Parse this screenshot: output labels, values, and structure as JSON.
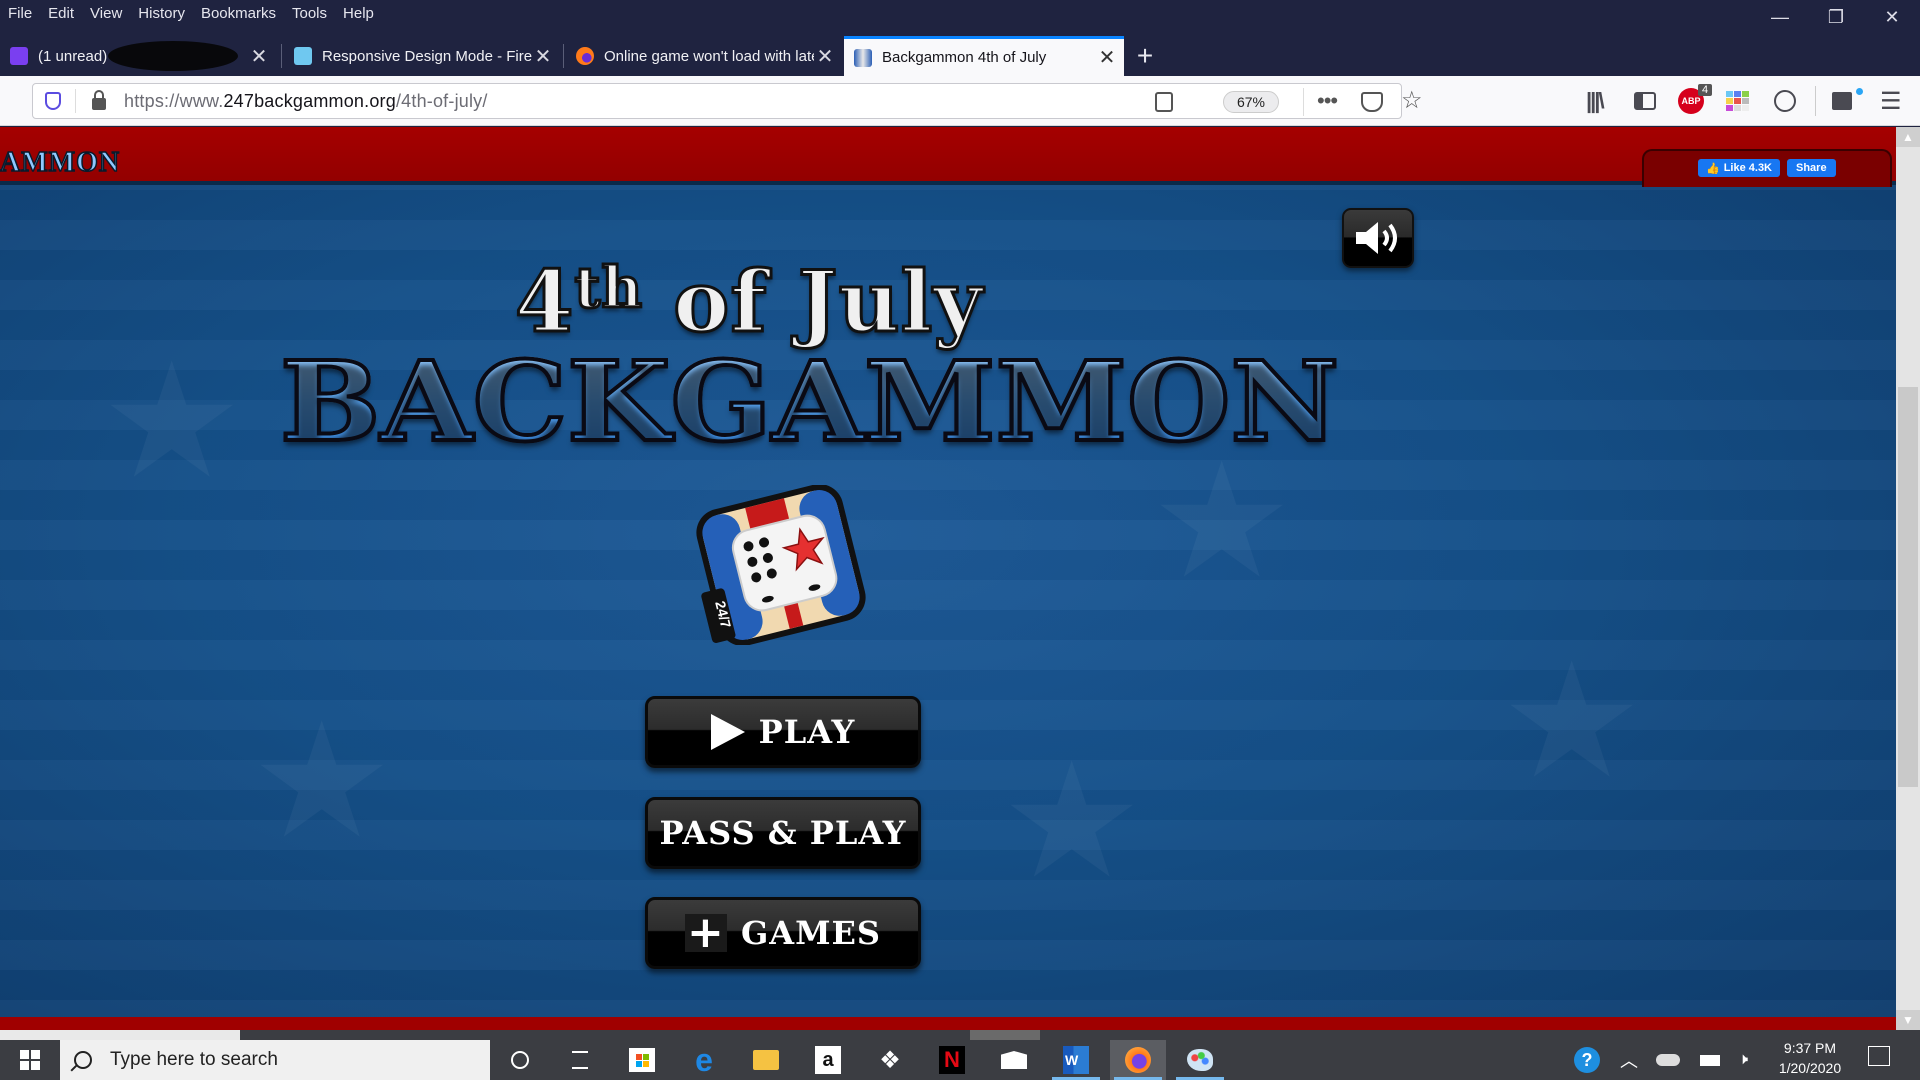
{
  "menubar": {
    "items": [
      "File",
      "Edit",
      "View",
      "History",
      "Bookmarks",
      "Tools",
      "Help"
    ]
  },
  "window_controls": {
    "minimize": "—",
    "restore": "❐",
    "close": "✕"
  },
  "tabs": [
    {
      "label": "(1 unread)",
      "icon": "mail-icon",
      "icon_color": "#7a3ff0",
      "active": false
    },
    {
      "label": "Responsive Design Mode - Firefox",
      "icon": "devtools-icon",
      "icon_color": "#6fc8f0",
      "active": false
    },
    {
      "label": "Online game won't load with latest",
      "icon": "firefox-icon",
      "icon_color": "#ff7a1a",
      "active": false
    },
    {
      "label": "Backgammon 4th of July",
      "icon": "backgammon-icon",
      "icon_color": "#2c5fb5",
      "active": true
    }
  ],
  "new_tab_label": "+",
  "tab_close_glyph": "✕",
  "navbar": {
    "url_prefix": "https://www.",
    "url_domain": "247backgammon.org",
    "url_path": "/4th-of-july/",
    "zoom_level": "67%",
    "more_glyph": "•••",
    "star_glyph": "☆",
    "abp_label": "ABP",
    "abp_badge": "4"
  },
  "page": {
    "header_logo_fragment": "AMMON",
    "fb_like_label": "Like 4.3K",
    "fb_share_label": "Share",
    "title_line1_pre": "4",
    "title_line1_sup": "th",
    "title_line1_post": " of July",
    "title_line2": "BACKGAMMON",
    "icon_badge": "24/7",
    "buttons": {
      "play": "PLAY",
      "pass_and_play": "PASS & PLAY",
      "games": "GAMES"
    }
  },
  "colors": {
    "header_red": "#a00000",
    "page_blue": "#155089",
    "button_black": "#000000",
    "title_blue": "#5aa8f5",
    "firefox_accent": "#0a84ff"
  },
  "taskbar": {
    "search_placeholder": "Type here to search",
    "apps": [
      "cortana",
      "task-view",
      "microsoft-store",
      "edge",
      "file-explorer",
      "amazon",
      "dropbox",
      "netflix",
      "mail",
      "word",
      "firefox",
      "paint"
    ],
    "time": "9:37 PM",
    "date": "1/20/2020"
  }
}
